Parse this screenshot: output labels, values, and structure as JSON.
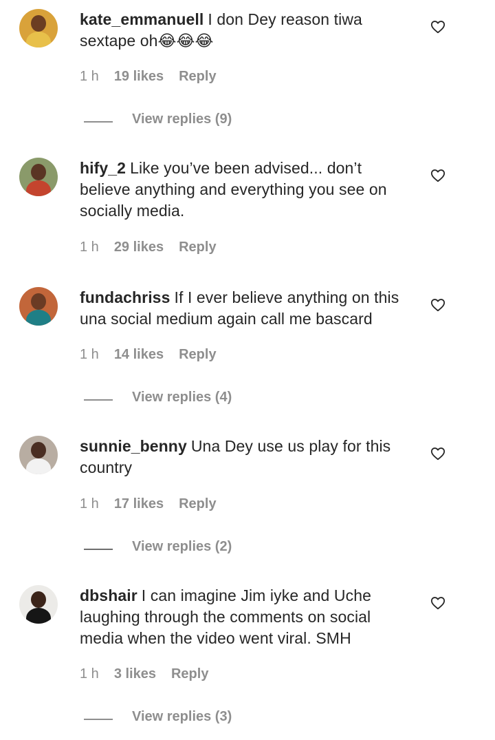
{
  "comments": [
    {
      "username": "kate_emmanuell",
      "text": "I don Dey reason tiwa sextape oh😂😂😂",
      "time": "1 h",
      "likes": "19 likes",
      "reply": "Reply",
      "view_replies": "View replies (9)",
      "avatar_colors": {
        "bg": "#d9a23a",
        "skin": "#6b3d22",
        "body": "#e8c04a"
      }
    },
    {
      "username": "hify_2",
      "text": "Like you’ve been advised... don’t believe anything and everything you see on socially media.",
      "time": "1 h",
      "likes": "29 likes",
      "reply": "Reply",
      "view_replies": "",
      "avatar_colors": {
        "bg": "#8a9a6a",
        "skin": "#5a3524",
        "body": "#c4442e"
      }
    },
    {
      "username": "fundachriss",
      "text": "If I ever believe anything on this una social medium again call me bascard",
      "time": "1 h",
      "likes": "14 likes",
      "reply": "Reply",
      "view_replies": "View replies (4)",
      "avatar_colors": {
        "bg": "#c2663a",
        "skin": "#6a3b24",
        "body": "#1f7f86"
      }
    },
    {
      "username": "sunnie_benny",
      "text": "Una Dey use us play for this country",
      "time": "1 h",
      "likes": "17 likes",
      "reply": "Reply",
      "view_replies": "View replies (2)",
      "avatar_colors": {
        "bg": "#b8ada2",
        "skin": "#4a2e22",
        "body": "#f2f2f2"
      }
    },
    {
      "username": "dbshair",
      "text": "I can imagine Jim iyke and Uche laughing through the comments on social media when the video went viral. SMH",
      "time": "1 h",
      "likes": "3 likes",
      "reply": "Reply",
      "view_replies": "View replies (3)",
      "avatar_colors": {
        "bg": "#ecebe8",
        "skin": "#3b2419",
        "body": "#161616"
      }
    }
  ]
}
